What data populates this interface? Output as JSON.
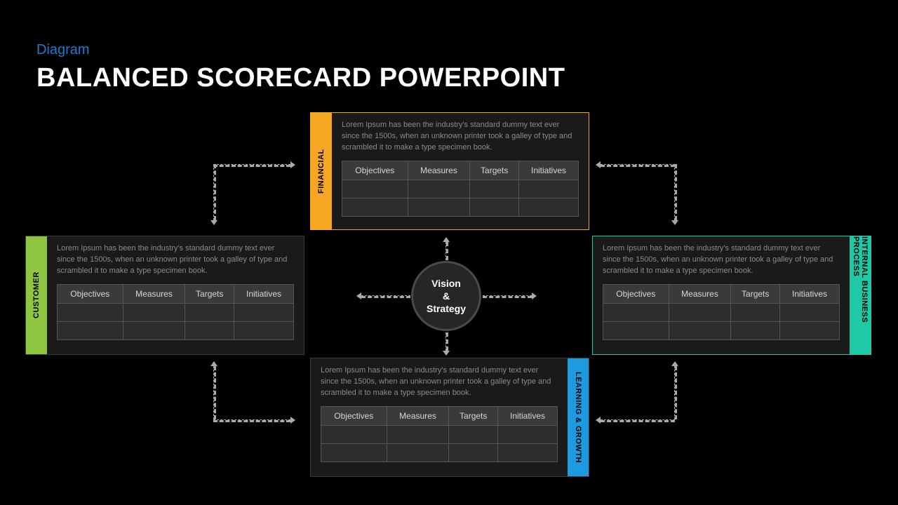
{
  "header": {
    "subtitle": "Diagram",
    "subtitle_color": "#1e7bd6",
    "title": "BALANCED SCORECARD POWERPOINT"
  },
  "hub": {
    "line1": "Vision",
    "line2": "&",
    "line3": "Strategy"
  },
  "columns": {
    "c1": "Objectives",
    "c2": "Measures",
    "c3": "Targets",
    "c4": "Initiatives"
  },
  "perspectives": {
    "financial": {
      "label": "FINANCIAL",
      "color": "#f5a623",
      "desc": "Lorem Ipsum has been the industry's standard dummy text ever since the 1500s, when an unknown printer took a galley of type and scrambled it to make a type specimen book."
    },
    "customer": {
      "label": "CUSTOMER",
      "color": "#8fc63f",
      "desc": "Lorem Ipsum has been the industry's standard dummy text ever since the 1500s, when an unknown printer took a galley of type and scrambled it to make a type specimen book."
    },
    "internal": {
      "label": "INTERNAL BUSINESS PROCESS",
      "color": "#1fc9a5",
      "desc": "Lorem Ipsum has been the industry's standard dummy text ever since the 1500s, when an unknown printer took a galley of type and scrambled it to make a type specimen book."
    },
    "learning": {
      "label": "LEARNING & GROWTH",
      "color": "#1e9be0",
      "desc": "Lorem Ipsum has been the industry's standard dummy text ever since the 1500s, when an unknown printer took a galley of type and scrambled it to make a type specimen book."
    }
  }
}
